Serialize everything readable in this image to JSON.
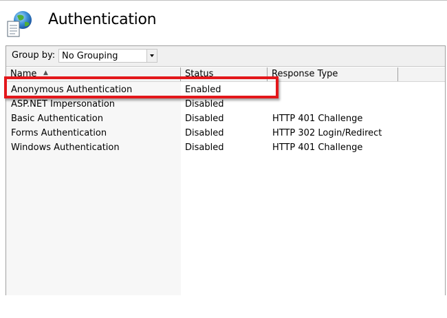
{
  "header": {
    "title": "Authentication",
    "icon": "iis-globe-document-icon"
  },
  "toolbar": {
    "group_by_label": "Group by:",
    "group_by_value": "No Grouping"
  },
  "table": {
    "columns": [
      "Name",
      "Status",
      "Response Type"
    ],
    "sort": {
      "column": "Name",
      "direction": "ascending"
    },
    "rows": [
      {
        "name": "Anonymous Authentication",
        "status": "Enabled",
        "response_type": ""
      },
      {
        "name": "ASP.NET Impersonation",
        "status": "Disabled",
        "response_type": ""
      },
      {
        "name": "Basic Authentication",
        "status": "Disabled",
        "response_type": "HTTP 401 Challenge"
      },
      {
        "name": "Forms Authentication",
        "status": "Disabled",
        "response_type": "HTTP 302 Login/Redirect"
      },
      {
        "name": "Windows Authentication",
        "status": "Disabled",
        "response_type": "HTTP 401 Challenge"
      }
    ]
  },
  "annotation": {
    "highlighted_row": "Anonymous Authentication",
    "color": "#e3171b"
  }
}
